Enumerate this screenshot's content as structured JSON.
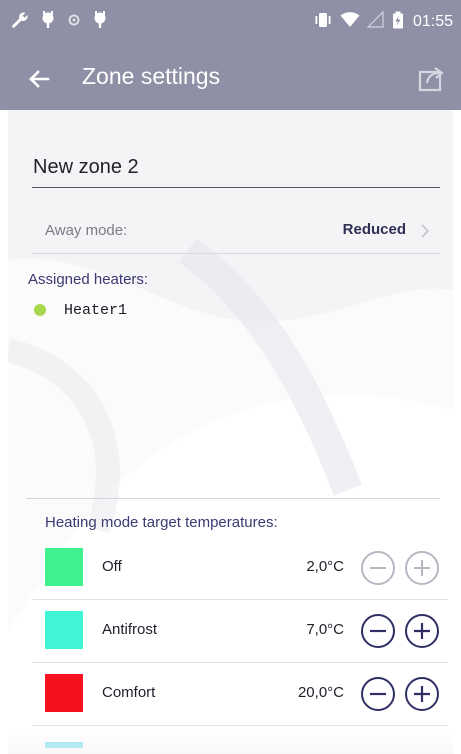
{
  "status_bar": {
    "time": "01:55",
    "left_icons": [
      "wrench-icon",
      "notification-icon",
      "notification-icon",
      "notification-icon"
    ],
    "right_icons": [
      "vibrate-icon",
      "wifi-icon",
      "signal-icon",
      "battery-icon"
    ]
  },
  "app_bar": {
    "title": "Zone settings",
    "back_icon": "arrow-left-icon",
    "action_icon": "share-icon"
  },
  "zone": {
    "name": "New zone 2"
  },
  "away_mode": {
    "label": "Away mode:",
    "value": "Reduced"
  },
  "assigned_heaters": {
    "label": "Assigned heaters:",
    "items": [
      {
        "name": "Heater1",
        "status_color": "#a8d64e"
      }
    ]
  },
  "temperatures": {
    "header": "Heating mode target temperatures:",
    "modes": [
      {
        "name": "Off",
        "temp": "2,0°C",
        "color": "#3ff28f",
        "buttons_enabled": false
      },
      {
        "name": "Antifrost",
        "temp": "7,0°C",
        "color": "#3ff5d3",
        "buttons_enabled": true
      },
      {
        "name": "Comfort",
        "temp": "20,0°C",
        "color": "#f5111d",
        "buttons_enabled": true
      }
    ],
    "next_mode_color": "#8be3ef"
  },
  "colors": {
    "app_bar": "#8f8fa6",
    "accent_text": "#3a3a72",
    "button_enabled": "#2f2f66",
    "button_disabled": "#b8b8c2"
  }
}
